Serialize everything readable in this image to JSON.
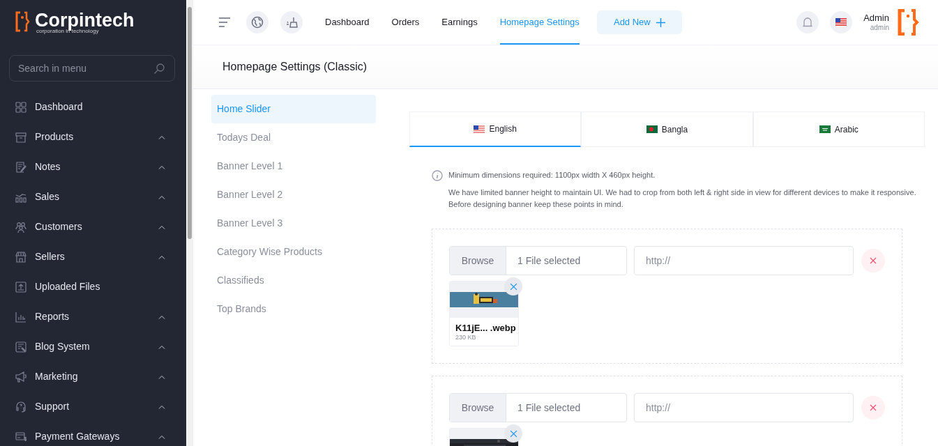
{
  "brand": {
    "name": "Corpintech",
    "tagline": "corporation in technology"
  },
  "sidebar": {
    "search": {
      "placeholder": "Search in menu"
    },
    "items": [
      {
        "label": "Dashboard",
        "expandable": false
      },
      {
        "label": "Products",
        "expandable": true
      },
      {
        "label": "Notes",
        "expandable": true
      },
      {
        "label": "Sales",
        "expandable": true
      },
      {
        "label": "Customers",
        "expandable": true
      },
      {
        "label": "Sellers",
        "expandable": true
      },
      {
        "label": "Uploaded Files",
        "expandable": false
      },
      {
        "label": "Reports",
        "expandable": true
      },
      {
        "label": "Blog System",
        "expandable": true
      },
      {
        "label": "Marketing",
        "expandable": true
      },
      {
        "label": "Support",
        "expandable": true
      },
      {
        "label": "Payment Gateways",
        "expandable": true
      }
    ]
  },
  "topbar": {
    "nav": [
      {
        "label": "Dashboard",
        "selected": false
      },
      {
        "label": "Orders",
        "selected": false
      },
      {
        "label": "Earnings",
        "selected": false
      },
      {
        "label": "Homepage Settings",
        "selected": true
      }
    ],
    "add_button": "Add New",
    "user": {
      "name": "Admin",
      "role": "admin"
    }
  },
  "page": {
    "title": "Homepage Settings (Classic)"
  },
  "settings_menu": [
    {
      "label": "Home Slider",
      "selected": true
    },
    {
      "label": "Todays Deal",
      "selected": false
    },
    {
      "label": "Banner Level 1",
      "selected": false
    },
    {
      "label": "Banner Level 2",
      "selected": false
    },
    {
      "label": "Banner Level 3",
      "selected": false
    },
    {
      "label": "Category Wise Products",
      "selected": false
    },
    {
      "label": "Classifieds",
      "selected": false
    },
    {
      "label": "Top Brands",
      "selected": false
    }
  ],
  "language_tabs": [
    {
      "label": "English",
      "selected": true
    },
    {
      "label": "Bangla",
      "selected": false
    },
    {
      "label": "Arabic",
      "selected": false
    }
  ],
  "notes": [
    "Minimum dimensions required: 1100px width X 460px height.",
    "We have limited banner height to maintain UI. We had to crop from both left & right side in view for different devices to make it responsive. Before designing banner keep these points in mind."
  ],
  "sliders": [
    {
      "browse": "Browse",
      "file_status": "1 File selected",
      "link_placeholder": "http://",
      "preview": {
        "kind": "picture",
        "name": "K11jE... .webp",
        "size": "230 KB"
      }
    },
    {
      "browse": "Browse",
      "file_status": "1 File selected",
      "link_placeholder": "http://"
    }
  ]
}
